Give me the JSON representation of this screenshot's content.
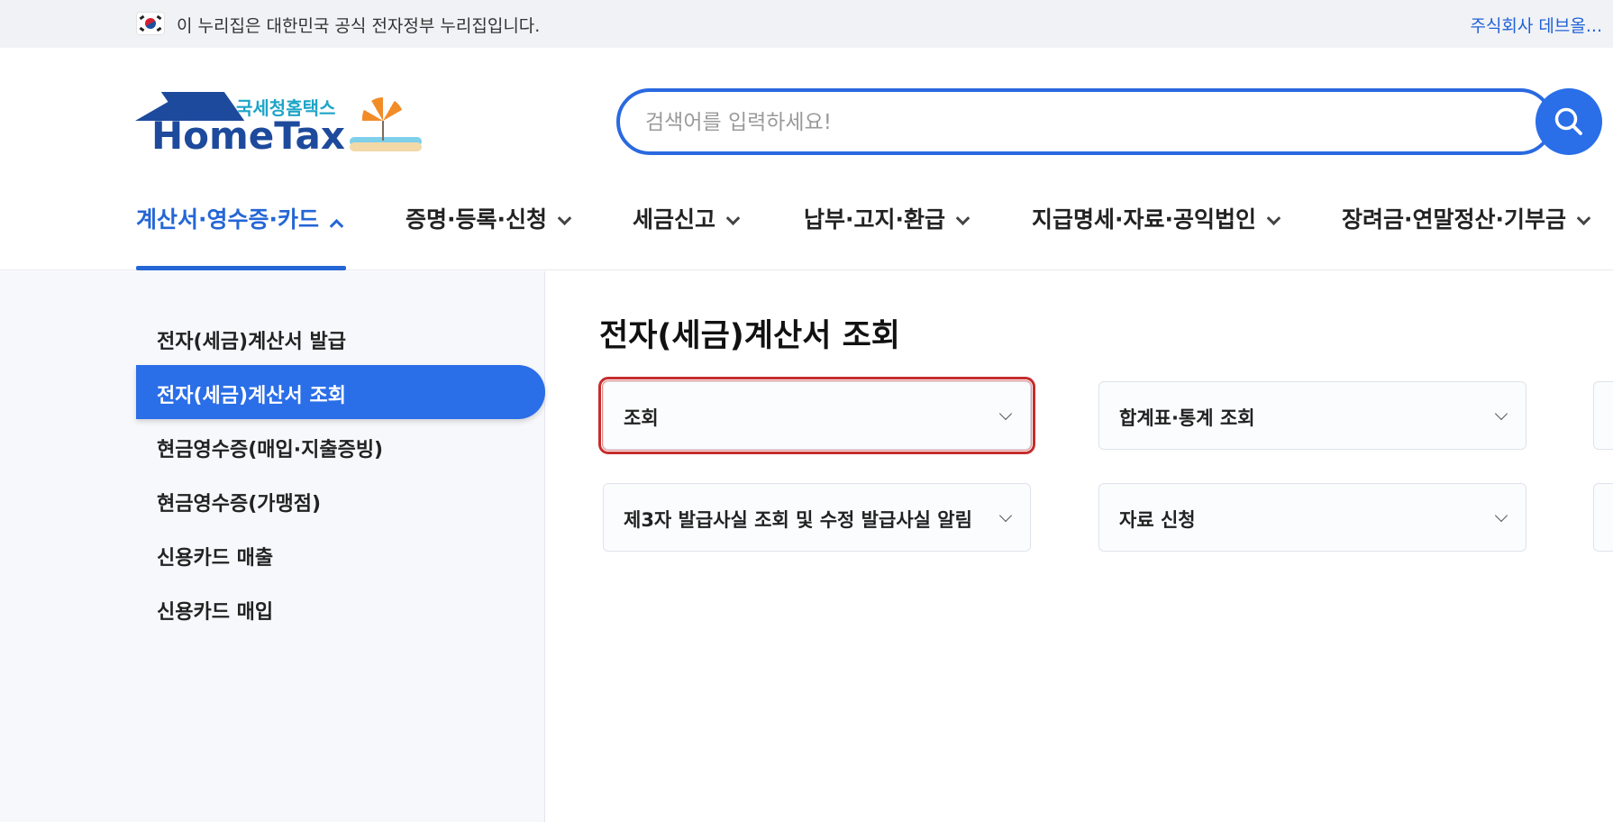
{
  "gov_banner": {
    "text": "이 누리집은 대한민국 공식 전자정부 누리집입니다.",
    "company": "주식회사 데브올..."
  },
  "logo": {
    "korean": "국세청홈택스",
    "english": "HomeTax"
  },
  "search": {
    "placeholder": "검색어를 입력하세요!"
  },
  "gnb": {
    "items": [
      {
        "label": "계산서·영수증·카드",
        "active": true
      },
      {
        "label": "증명·등록·신청"
      },
      {
        "label": "세금신고"
      },
      {
        "label": "납부·고지·환급"
      },
      {
        "label": "지급명세·자료·공익법인"
      },
      {
        "label": "장려금·연말정산·기부금"
      }
    ]
  },
  "side": {
    "items": [
      {
        "label": "전자(세금)계산서 발급"
      },
      {
        "label": "전자(세금)계산서 조회",
        "active": true
      },
      {
        "label": "현금영수증(매입·지출증빙)"
      },
      {
        "label": "현금영수증(가맹점)"
      },
      {
        "label": "신용카드 매출"
      },
      {
        "label": "신용카드 매입"
      }
    ]
  },
  "main": {
    "title": "전자(세금)계산서 조회",
    "cards": [
      {
        "label": "조회",
        "focused": true
      },
      {
        "label": "합계표·통계 조회"
      },
      {
        "label": "제3자 발급사실 조회 및 수정 발급사실 알림"
      },
      {
        "label": "자료 신청"
      }
    ]
  },
  "colors": {
    "accent": "#2a6ee8",
    "focus_outline": "#c62d2d",
    "brand_navy": "#1d4a9c"
  }
}
